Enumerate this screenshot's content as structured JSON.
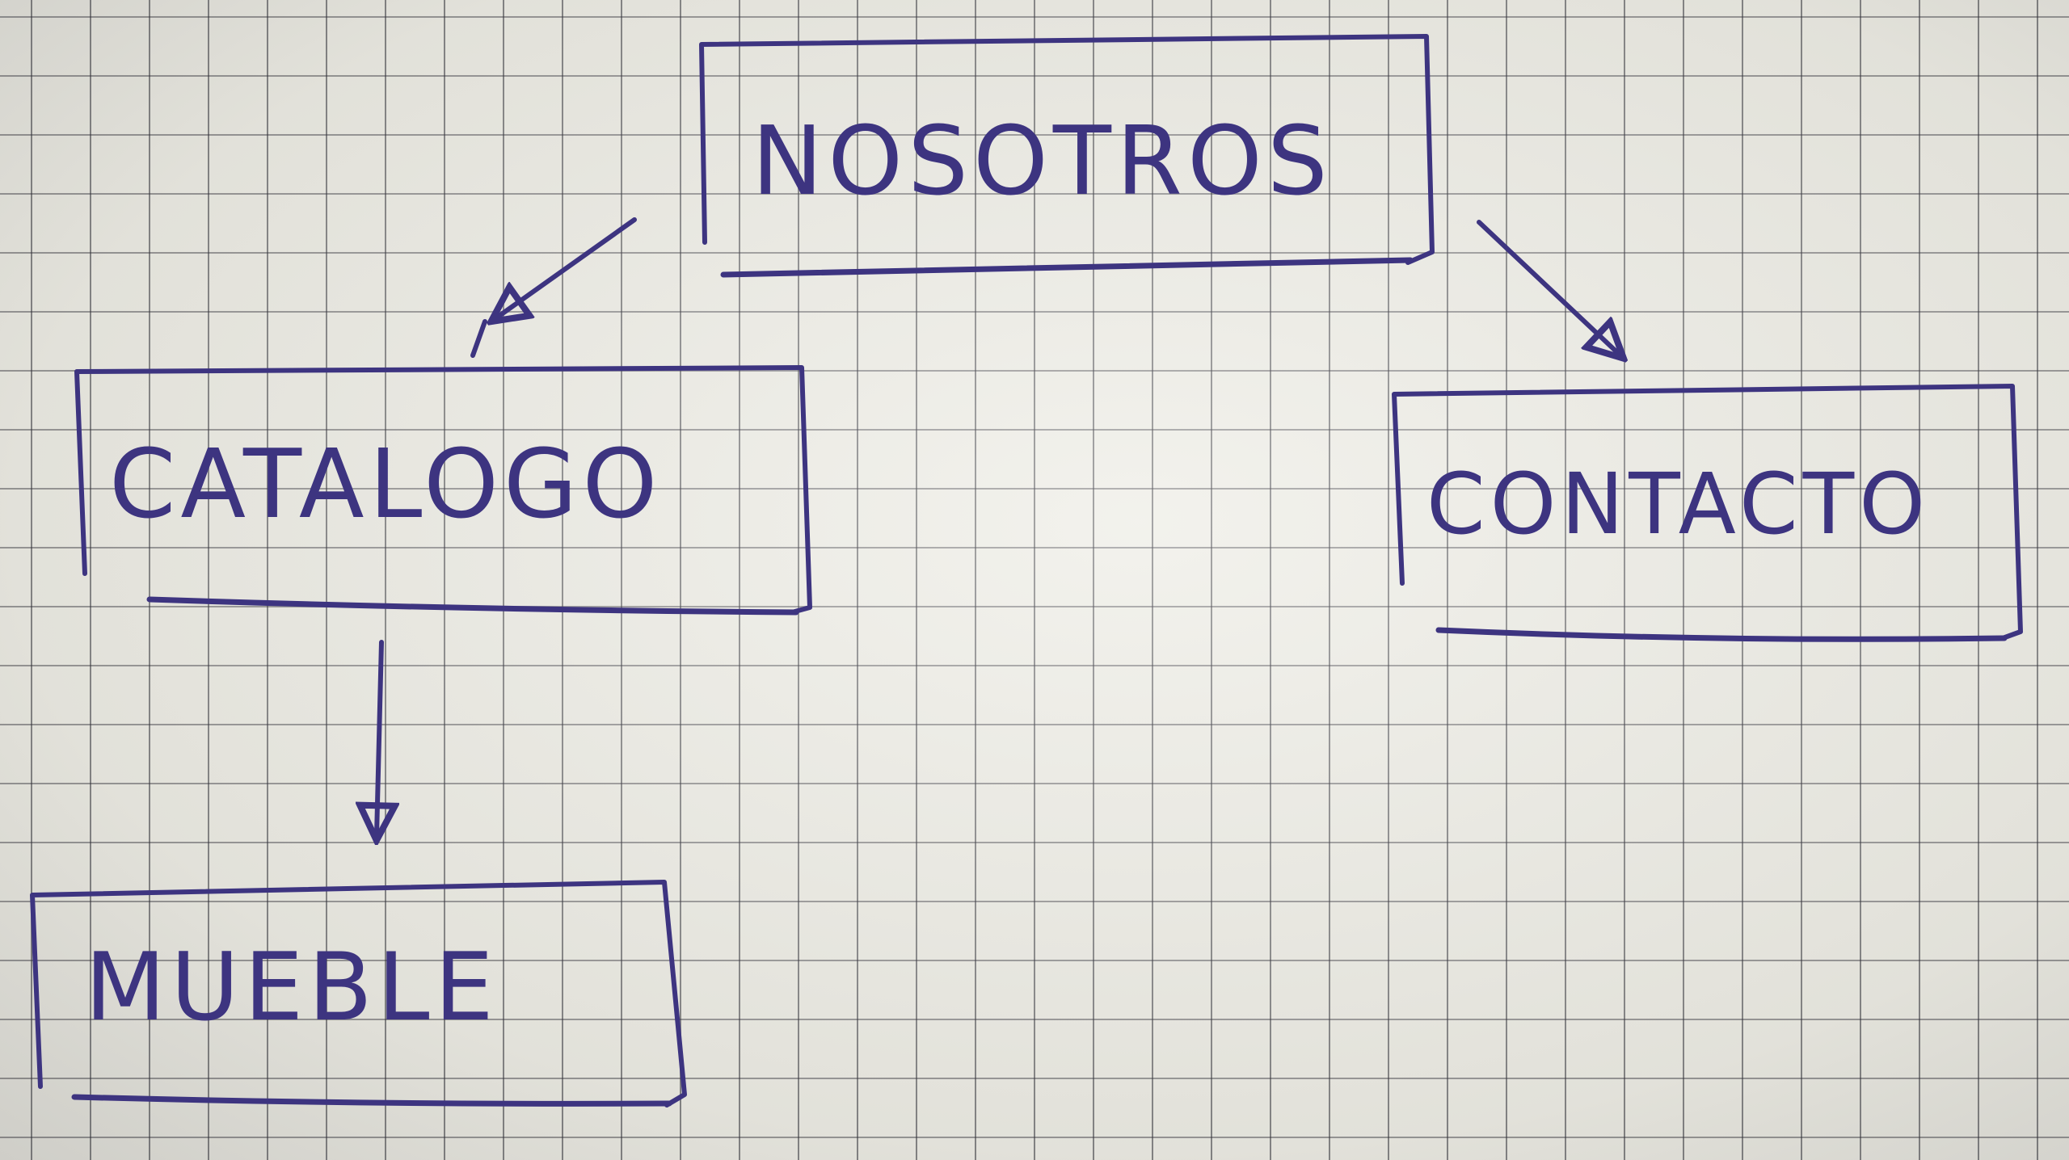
{
  "diagram": {
    "ink_color": "#3d3480",
    "nodes": [
      {
        "id": "nosotros",
        "label": "NOSOTROS"
      },
      {
        "id": "catalogo",
        "label": "CATALOGO"
      },
      {
        "id": "contacto",
        "label": "CONTACTO"
      },
      {
        "id": "mueble",
        "label": "MUEBLE"
      }
    ],
    "edges": [
      {
        "from": "nosotros",
        "to": "catalogo"
      },
      {
        "from": "nosotros",
        "to": "contacto"
      },
      {
        "from": "catalogo",
        "to": "mueble"
      }
    ]
  }
}
